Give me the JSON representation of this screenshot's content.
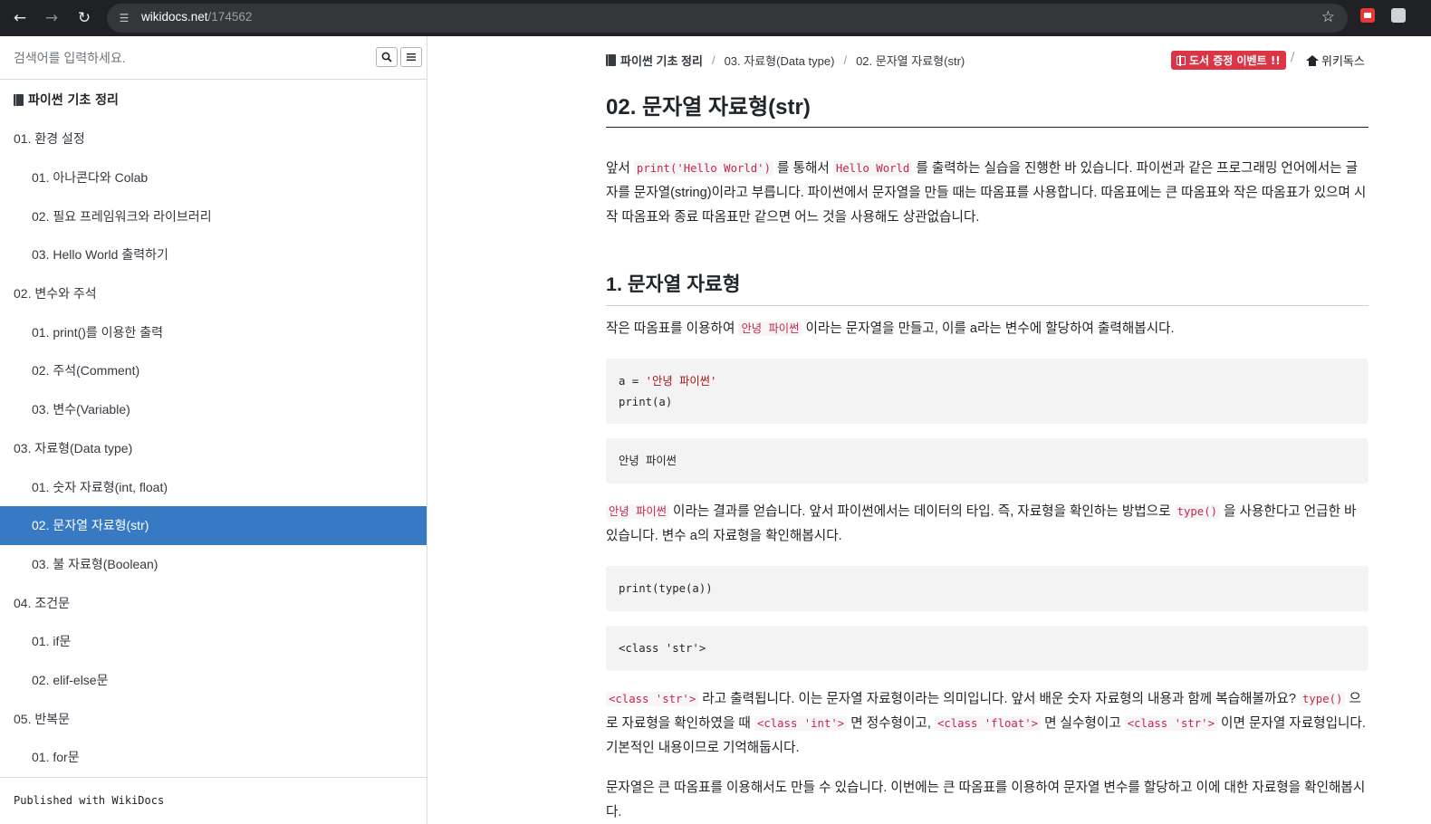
{
  "browser": {
    "url_host": "wikidocs.net",
    "url_path": "/174562"
  },
  "sidebar": {
    "search_placeholder": "검색어를 입력하세요.",
    "book_title": "파이썬 기초 정리",
    "items": [
      {
        "label": "01. 환경 설정",
        "level": 1
      },
      {
        "label": "01. 아나콘다와 Colab",
        "level": 2
      },
      {
        "label": "02. 필요 프레임워크와 라이브러리",
        "level": 2
      },
      {
        "label": "03. Hello World 출력하기",
        "level": 2
      },
      {
        "label": "02. 변수와 주석",
        "level": 1
      },
      {
        "label": "01. print()를 이용한 출력",
        "level": 2
      },
      {
        "label": "02. 주석(Comment)",
        "level": 2
      },
      {
        "label": "03. 변수(Variable)",
        "level": 2
      },
      {
        "label": "03. 자료형(Data type)",
        "level": 1
      },
      {
        "label": "01. 숫자 자료형(int, float)",
        "level": 2
      },
      {
        "label": "02. 문자열 자료형(str)",
        "level": 2,
        "active": true
      },
      {
        "label": "03. 불 자료형(Boolean)",
        "level": 2
      },
      {
        "label": "04. 조건문",
        "level": 1
      },
      {
        "label": "01. if문",
        "level": 2
      },
      {
        "label": "02. elif-else문",
        "level": 2
      },
      {
        "label": "05. 반복문",
        "level": 1
      },
      {
        "label": "01. for문",
        "level": 2
      }
    ],
    "footer": "Published with WikiDocs"
  },
  "header": {
    "breadcrumb": [
      "파이썬 기초 정리",
      "03. 자료형(Data type)",
      "02. 문자열 자료형(str)"
    ],
    "event_button": "도서 증정 이벤트 !!",
    "home_link": "위키독스"
  },
  "content": {
    "title": "02. 문자열 자료형(str)",
    "p1": {
      "t1": "앞서 ",
      "c1": "print('Hello World')",
      "t2": " 를 통해서 ",
      "c2": "Hello World",
      "t3": " 를 출력하는 실습을 진행한 바 있습니다. 파이썬과 같은 프로그래밍 언어에서는 글자를 문자열(string)이라고 부릅니다. 파이썬에서 문자열을 만들 때는 따옴표를 사용합니다. 따옴표에는 큰 따옴표와 작은 따옴표가 있으며 시작 따옴표와 종료 따옴표만 같으면 어느 것을 사용해도 상관없습니다."
    },
    "section1": "1. 문자열 자료형",
    "p2": {
      "t1": "작은 따옴표를 이용하여 ",
      "c1": "안녕 파이썬",
      "t2": " 이라는 문자열을 만들고, 이를 a라는 변수에 할당하여 출력해봅시다."
    },
    "code1": {
      "line1_a": "a = ",
      "line1_str": "'안녕 파이썬'",
      "line2": "print(a)"
    },
    "output1": "안녕 파이썬",
    "p3": {
      "c1": "안녕 파이썬",
      "t1": " 이라는 결과를 얻습니다. 앞서 파이썬에서는 데이터의 타입. 즉, 자료형을 확인하는 방법으로 ",
      "c2": "type()",
      "t2": " 을 사용한다고 언급한 바 있습니다. 변수 a의 자료형을 확인해봅시다."
    },
    "code2": "print(type(a))",
    "output2": "<class 'str'>",
    "p4": {
      "c1": "<class 'str'>",
      "t1": " 라고 출력됩니다. 이는 문자열 자료형이라는 의미입니다. 앞서 배운 숫자 자료형의 내용과 함께 복습해볼까요? ",
      "c2": "type()",
      "t2": " 으로 자료형을 확인하였을 때 ",
      "c3": "<class 'int'>",
      "t3": " 면 정수형이고, ",
      "c4": "<class 'float'>",
      "t4": " 면 실수형이고 ",
      "c5": "<class 'str'>",
      "t5": " 이면 문자열 자료형입니다. 기본적인 내용이므로 기억해둡시다."
    },
    "p5": "문자열은 큰 따옴표를 이용해서도 만들 수 있습니다. 이번에는 큰 따옴표를 이용하여 문자열 변수를 할당하고 이에 대한 자료형을 확인해봅시다."
  }
}
